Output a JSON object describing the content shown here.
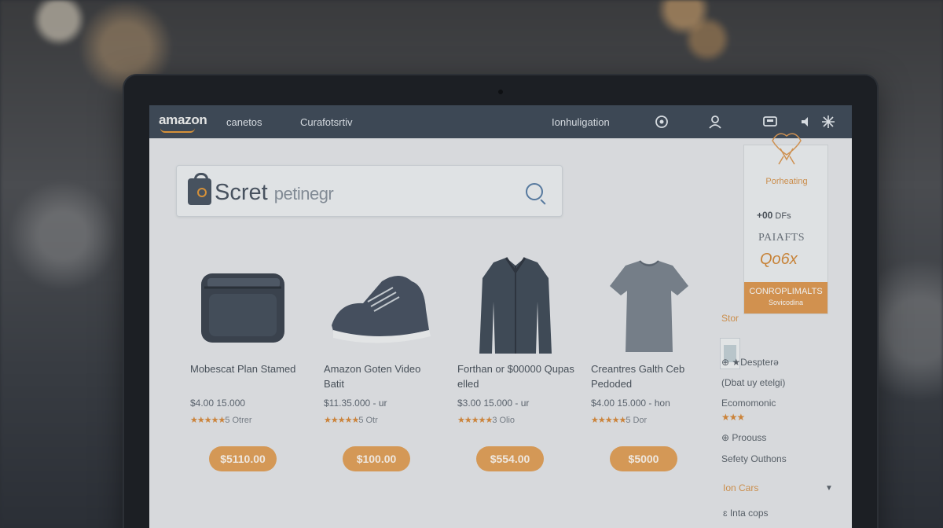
{
  "header": {
    "logo": "amazon",
    "nav_1": "canetos",
    "nav_2": "Curafotsrtiv",
    "nav_3": "Ionhuligation"
  },
  "search": {
    "brand_word": "Scret",
    "placeholder": "petinegr"
  },
  "products": [
    {
      "name": "Mobescat Plan Stamed",
      "price": "$4.00 15.000",
      "rating_stars": "★★★★★",
      "rating_text": "5 Otrer",
      "button": "$5110.00"
    },
    {
      "name": "Amazon Goten Video Batit",
      "price": "$11.35.000 - ur",
      "rating_stars": "★★★★★",
      "rating_text": "5 Otr",
      "button": "$100.00"
    },
    {
      "name": "Forthan or $00000 Qupas elled",
      "price": "$3.00 15.000 - ur",
      "rating_stars": "★★★★★",
      "rating_text": "3 Olio",
      "button": "$554.00"
    },
    {
      "name": "Creantres Galth Ceb Pedoded",
      "price": "$4.00 15.000 - hon",
      "rating_stars": "★★★★★",
      "rating_text": "5 Dor",
      "button": "$5000"
    }
  ],
  "promo": {
    "title": "Porheating",
    "line1_value": "+00",
    "line1_unit": "DFs",
    "parts": "PAIAFTS",
    "handwritten": "Qo6x",
    "cta": "CONROPLIMALTS",
    "cta_small": "Sovicodina"
  },
  "sidebar": {
    "store_label": "Stor",
    "item_1": "⊕ ★Despterə",
    "item_2": "(Dbat uy etelgi)",
    "item_3": "Ecomomonic",
    "item_3_stars": "★★★",
    "item_4": "⊕ Proouss",
    "item_5": "Sefety Outhons",
    "dropdown": "Ion Cars",
    "footer": "ɛ Inta cops"
  },
  "colors": {
    "header_bg": "#3f4a58",
    "accent_orange": "#e3a15a",
    "screen_bg": "#e6e8eb"
  }
}
